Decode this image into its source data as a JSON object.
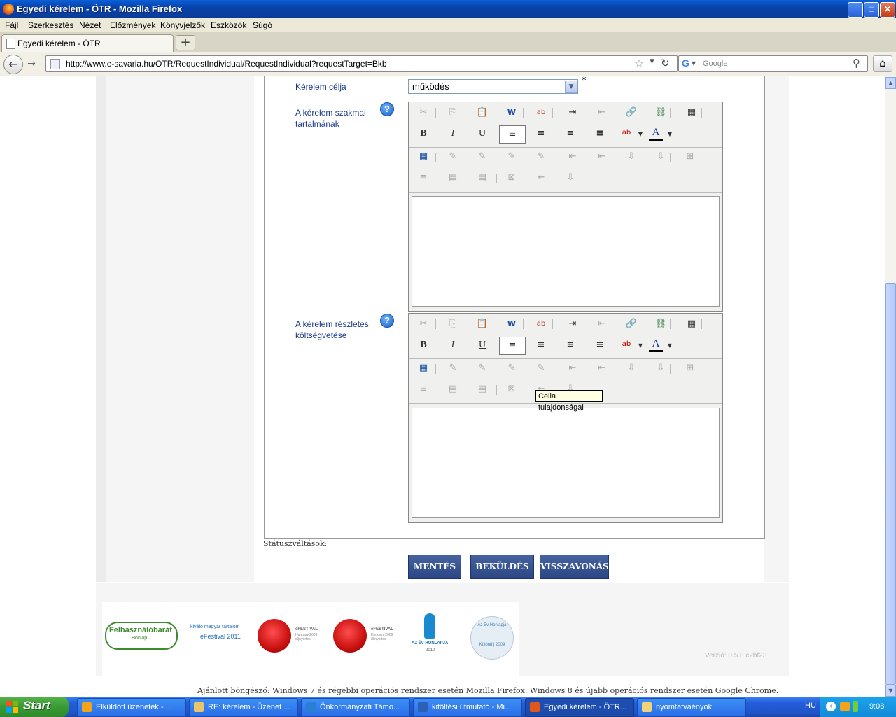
{
  "window": {
    "title": "Egyedi kérelem - ÖTR - Mozilla Firefox",
    "buttons": {
      "minimize": "_",
      "maximize": "□",
      "close": "✕"
    }
  },
  "menu": [
    "Fájl",
    "Szerkesztés",
    "Nézet",
    "Előzmények",
    "Könyvjelzők",
    "Eszközök",
    "Súgó"
  ],
  "tabs": [
    {
      "label": "Egyedi kérelem - ÖTR"
    }
  ],
  "newtab_label": "+",
  "nav": {
    "url": "http://www.e-savaria.hu/OTR/RequestIndividual/RequestIndividual?requestTarget=Bkb",
    "search_placeholder": "Google",
    "search_engine_glyph": "G"
  },
  "form": {
    "purpose_label": "Kérelem célja",
    "purpose_value": "működés",
    "required_marker": "*",
    "field1_label_line1": "A kérelem szakmai",
    "field1_label_line2": "tartalmának",
    "field2_label_line1": "A kérelem részletes",
    "field2_label_line2": "költségvetése",
    "help_glyph": "?"
  },
  "editor": {
    "icons_row1": [
      "cut-icon",
      "copy-icon",
      "paste-icon",
      "paste-word-icon",
      "spellcheck-icon",
      "indent-icon",
      "outdent-icon",
      "link-icon",
      "unlink-icon",
      "table-icon"
    ],
    "format_labels": {
      "bold": "B",
      "italic": "I",
      "underline": "U",
      "font_color": "A",
      "highlight": "ab"
    },
    "tooltip": "Cella tulajdonságai"
  },
  "status_label": "Státuszváltások:",
  "actions": {
    "save": "MENTÉS",
    "submit": "BEKÜLDÉS",
    "withdraw": "VISSZAVONÁS"
  },
  "footer": {
    "logos": [
      {
        "name": "felhasznalobarat-logo",
        "text": "Felhasználóbarát",
        "sub": "Honlap"
      },
      {
        "name": "efestival-2011-logo",
        "text": "kiváló magyar tartalom",
        "sub": "eFestival 2011"
      },
      {
        "name": "efestival-2009-logo-1",
        "text": "eFESTIVAL",
        "sub": "Hungary 2009 díjnyertes"
      },
      {
        "name": "efestival-2009-logo-2",
        "text": "eFESTIVAL",
        "sub": "Hungary 2009 díjnyertes"
      },
      {
        "name": "az-ev-honlapja-2010-logo",
        "text": "AZ ÉV HONLAPJA",
        "sub": "2010"
      },
      {
        "name": "az-ev-honlapja-2009-logo",
        "text": "Az Év Honlapja",
        "sub": "Különdíj 2009"
      }
    ],
    "version": "Verzió: 0.5.8.c2bf23",
    "note": "Ajánlott böngésző: Windows 7 és régebbi operációs rendszer esetén Mozilla Firefox. Windows 8 és újabb operációs rendszer esetén Google Chrome."
  },
  "taskbar": {
    "start": "Start",
    "tasks": [
      {
        "label": "Elküldött üzenetek - ...",
        "color": "#f3a21c"
      },
      {
        "label": "RE: kérelem - Üzenet ...",
        "color": "#e9c46a"
      },
      {
        "label": "Önkormányzati Támo...",
        "color": "#2a7fd4"
      },
      {
        "label": "kitöltési útmutató - Mi...",
        "color": "#2b5fb8"
      },
      {
        "label": "Egyedi kérelem - ÖTR...",
        "color": "#e2551b"
      },
      {
        "label": "nyomtatvaényok",
        "color": "#f1d27a"
      }
    ],
    "lang": "HU",
    "clock": "9:08"
  }
}
